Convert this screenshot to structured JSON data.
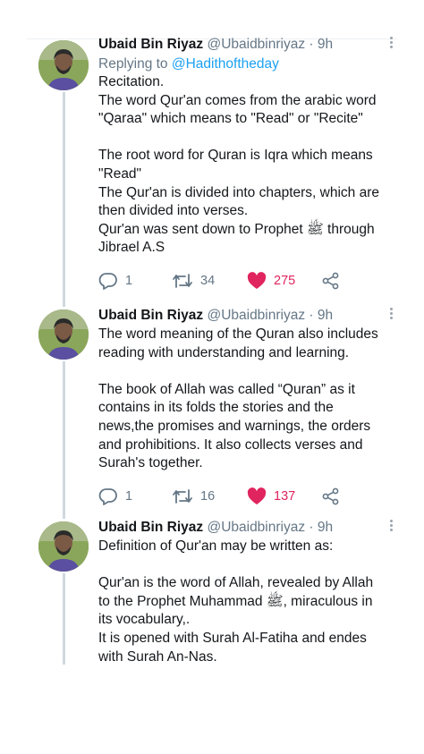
{
  "tweets": [
    {
      "name": "Ubaid Bin Riyaz",
      "handle": "@Ubaidbinriyaz",
      "separator": "·",
      "time": "9h",
      "replying_prefix": "Replying to",
      "replying_handle": "@Hadithoftheday",
      "lines": [
        "Recitation.",
        "The word Qur'an comes from the arabic word",
        "\"Qaraa\" which means to \"Read\" or \"Recite\"",
        "",
        "The root word for Quran is Iqra which means",
        "\"Read\"",
        "The Qur'an is divided into chapters, which are",
        "then divided into verses.",
        "Qur'an was sent down to Prophet ﷺ through",
        "Jibrael A.S"
      ],
      "replies": "1",
      "retweets": "34",
      "likes": "275"
    },
    {
      "name": "Ubaid Bin Riyaz",
      "handle": "@Ubaidbinriyaz",
      "separator": "·",
      "time": "9h",
      "lines": [
        "The word meaning of the Quran also includes",
        "reading with understanding and learning.",
        "",
        "The book of Allah was called “Quran” as it",
        "contains in its folds the stories and the",
        "news,the promises and warnings, the orders",
        "and prohibitions. It also collects verses and",
        "Surah's together."
      ],
      "replies": "1",
      "retweets": "16",
      "likes": "137"
    },
    {
      "name": "Ubaid Bin Riyaz",
      "handle": "@Ubaidbinriyaz",
      "separator": "·",
      "time": "9h",
      "lines": [
        "Definition of Qur'an may be written as:",
        "",
        "Qur'an is the word of Allah, revealed by Allah",
        "to the Prophet Muhammad ﷺ, miraculous in",
        "its vocabulary,.",
        "It is opened with Surah Al-Fatiha and endes",
        "with Surah An-Nas."
      ]
    }
  ],
  "icons": {
    "reply": "reply-icon",
    "retweet": "retweet-icon",
    "like": "heart-icon",
    "share": "share-icon",
    "more": "more-icon"
  },
  "colors": {
    "link": "#1da1f2",
    "muted": "#657786",
    "like": "#e0245e",
    "thread_line": "#cfd9de"
  }
}
